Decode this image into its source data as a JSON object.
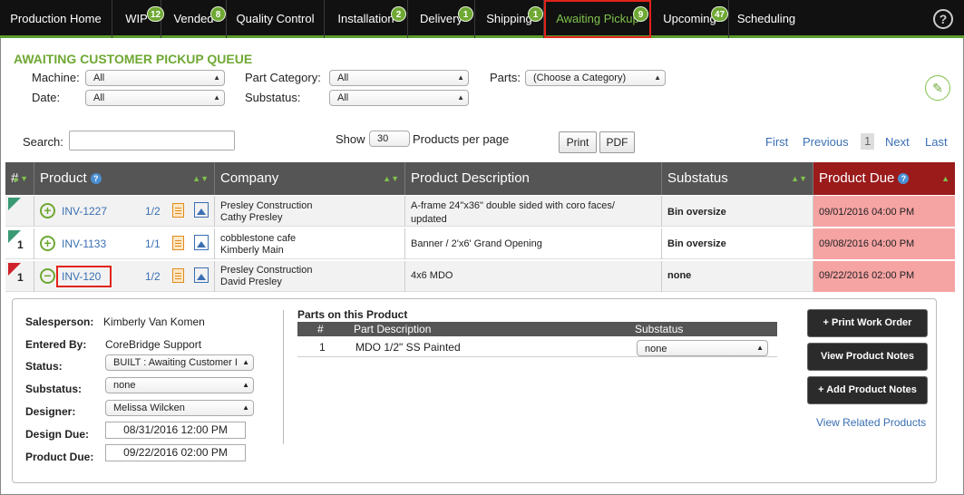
{
  "nav": {
    "items": [
      {
        "label": "Production Home",
        "badge": ""
      },
      {
        "label": "WIP",
        "badge": "12"
      },
      {
        "label": "Vended",
        "badge": "8"
      },
      {
        "label": "Quality Control",
        "badge": ""
      },
      {
        "label": "Installation",
        "badge": "2"
      },
      {
        "label": "Delivery",
        "badge": "1"
      },
      {
        "label": "Shipping",
        "badge": "1"
      },
      {
        "label": "Awaiting Pickup",
        "badge": "9"
      },
      {
        "label": "Upcoming",
        "badge": "47"
      },
      {
        "label": "Scheduling",
        "badge": ""
      }
    ],
    "help": "?"
  },
  "page": {
    "title": "AWAITING CUSTOMER PICKUP QUEUE"
  },
  "filters": {
    "machine_label": "Machine:",
    "machine_value": "All",
    "date_label": "Date:",
    "date_value": "All",
    "part_category_label": "Part Category:",
    "part_category_value": "All",
    "substatus_label": "Substatus:",
    "substatus_value": "All",
    "parts_label": "Parts:",
    "parts_value": "(Choose a Category)"
  },
  "toolbar": {
    "search_label": "Search:",
    "show_label": "Show",
    "per_page_value": "30",
    "per_page_label": "Products per page",
    "print": "Print",
    "pdf": "PDF",
    "first": "First",
    "previous": "Previous",
    "page": "1",
    "next": "Next",
    "last": "Last"
  },
  "table": {
    "headers": {
      "num": "#",
      "product": "Product",
      "company": "Company",
      "description": "Product Description",
      "substatus": "Substatus",
      "due": "Product Due"
    },
    "rows": [
      {
        "num": "",
        "invoice": "INV-1227",
        "qty": "1/2",
        "company1": "Presley Construction",
        "company2": "Cathy Presley",
        "desc1": "A-frame 24\"x36\" double sided with coro faces/",
        "desc2": "updated",
        "substatus": "Bin oversize",
        "due": "09/01/2016 04:00 PM",
        "flag": "green",
        "toggle": "+"
      },
      {
        "num": "1",
        "invoice": "INV-1133",
        "qty": "1/1",
        "company1": "cobblestone cafe",
        "company2": "Kimberly Main",
        "desc1": "Banner / 2'x6' Grand Opening",
        "desc2": "",
        "substatus": "Bin oversize",
        "due": "09/08/2016 04:00 PM",
        "flag": "green",
        "toggle": "+"
      },
      {
        "num": "1",
        "invoice": "INV-120",
        "qty": "1/2",
        "company1": "Presley Construction",
        "company2": "David Presley",
        "desc1": "4x6 MDO",
        "desc2": "",
        "substatus": "none",
        "due": "09/22/2016 02:00 PM",
        "flag": "red",
        "toggle": "−"
      }
    ]
  },
  "detail": {
    "salesperson_label": "Salesperson:",
    "salesperson": "Kimberly Van Komen",
    "entered_label": "Entered By:",
    "entered": "CoreBridge Support",
    "status_label": "Status:",
    "status": "BUILT : Awaiting Customer I",
    "substatus_label": "Substatus:",
    "substatus": "none",
    "designer_label": "Designer:",
    "designer": "Melissa Wilcken",
    "design_due_label": "Design Due:",
    "design_due": "08/31/2016 12:00 PM",
    "product_due_label": "Product Due:",
    "product_due": "09/22/2016 02:00 PM",
    "parts_title": "Parts on this Product",
    "parts_headers": {
      "num": "#",
      "desc": "Part Description",
      "substatus": "Substatus"
    },
    "parts": [
      {
        "num": "1",
        "desc": "MDO 1/2\" SS Painted",
        "substatus": "none"
      }
    ],
    "buttons": {
      "print_work_order": "+ Print Work Order",
      "view_notes": "View Product Notes",
      "add_notes": "+ Add Product Notes"
    },
    "view_related": "View Related Products"
  },
  "colors": {
    "accent": "#6fa833",
    "nav_bg": "#111111",
    "due_bg": "#f6a3a3",
    "link": "#3a6fb3"
  }
}
